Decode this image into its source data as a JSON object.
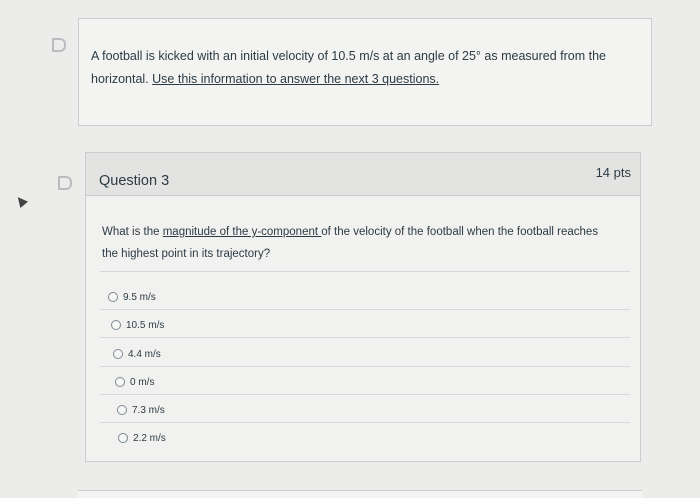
{
  "intro": {
    "text_line1": "A football is kicked with an initial velocity of 10.5 m/s at an angle of 25° as measured from the",
    "text_line2_plain": "horizontal. ",
    "text_line2_link": "Use this information to answer the next 3 questions."
  },
  "question": {
    "title": "Question 3",
    "points": "14 pts",
    "prompt_pre": "What is the ",
    "prompt_link": "magnitude of the y-component ",
    "prompt_post": "of the velocity of the football when the football reaches the highest point in its trajectory?",
    "answers": [
      {
        "label": "9.5 m/s"
      },
      {
        "label": "10.5 m/s"
      },
      {
        "label": "4.4 m/s"
      },
      {
        "label": "0 m/s"
      },
      {
        "label": "7.3 m/s"
      },
      {
        "label": "2.2 m/s"
      }
    ]
  },
  "colors": {
    "background": "#ececea",
    "text": "#2d3b45",
    "border": "#c7cdd1",
    "header": "#e3e4e2"
  }
}
